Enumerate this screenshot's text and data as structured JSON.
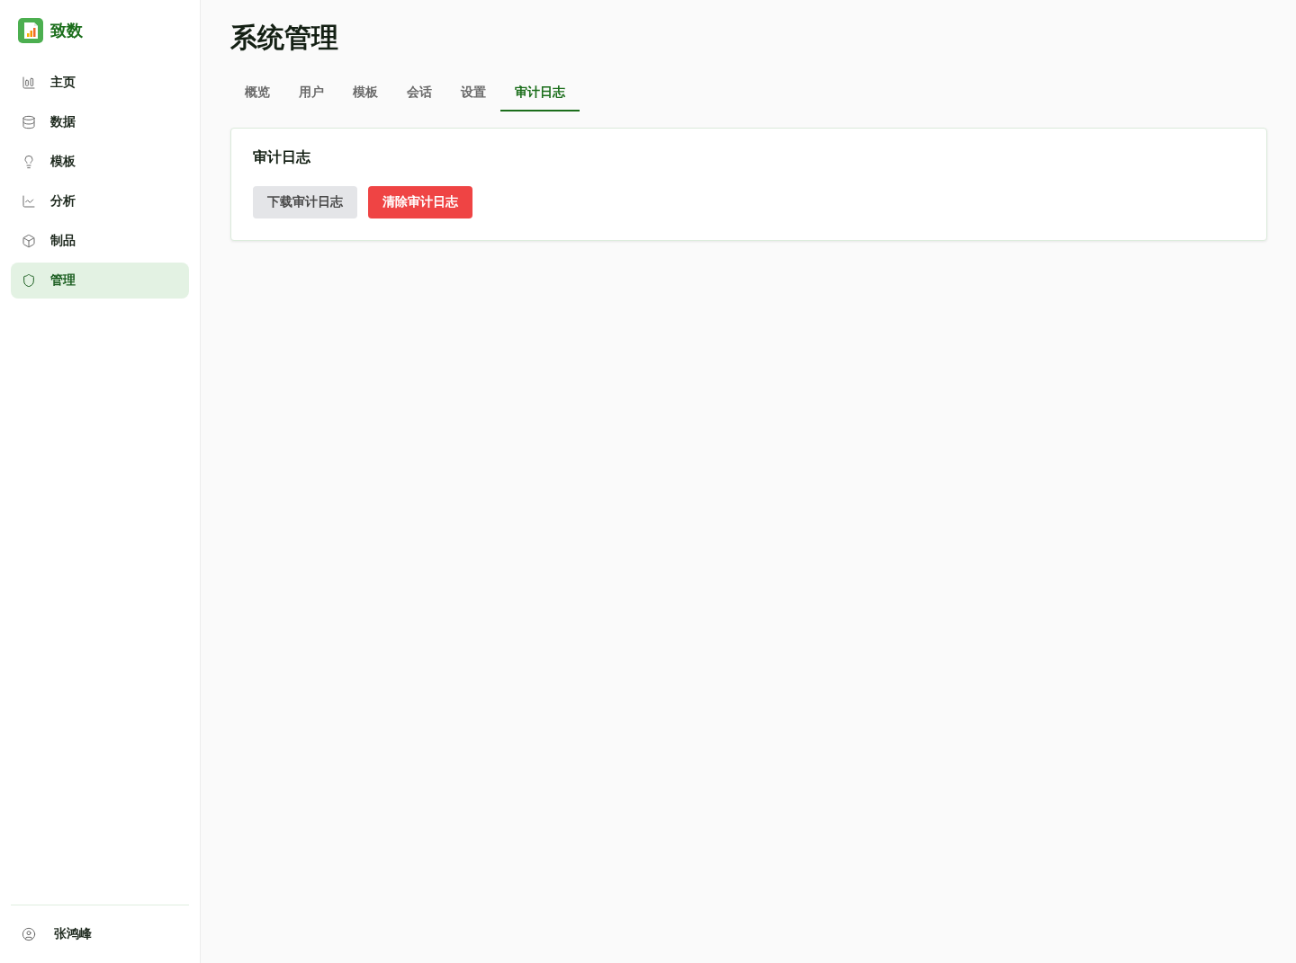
{
  "sidebar": {
    "brand": "致数",
    "items": [
      {
        "label": "主页",
        "selected": false
      },
      {
        "label": "数据",
        "selected": false
      },
      {
        "label": "模板",
        "selected": false
      },
      {
        "label": "分析",
        "selected": false
      },
      {
        "label": "制品",
        "selected": false
      },
      {
        "label": "管理",
        "selected": true
      }
    ],
    "user": {
      "name": "张鸿峰"
    }
  },
  "page": {
    "title": "系统管理"
  },
  "tabs": [
    {
      "label": "概览",
      "selected": false
    },
    {
      "label": "用户",
      "selected": false
    },
    {
      "label": "模板",
      "selected": false
    },
    {
      "label": "会话",
      "selected": false
    },
    {
      "label": "设置",
      "selected": false
    },
    {
      "label": "审计日志",
      "selected": true
    }
  ],
  "panel": {
    "title": "审计日志",
    "buttons": [
      {
        "label": "下载审计日志",
        "kind": "secondary"
      },
      {
        "label": "清除审计日志",
        "kind": "danger"
      }
    ]
  }
}
